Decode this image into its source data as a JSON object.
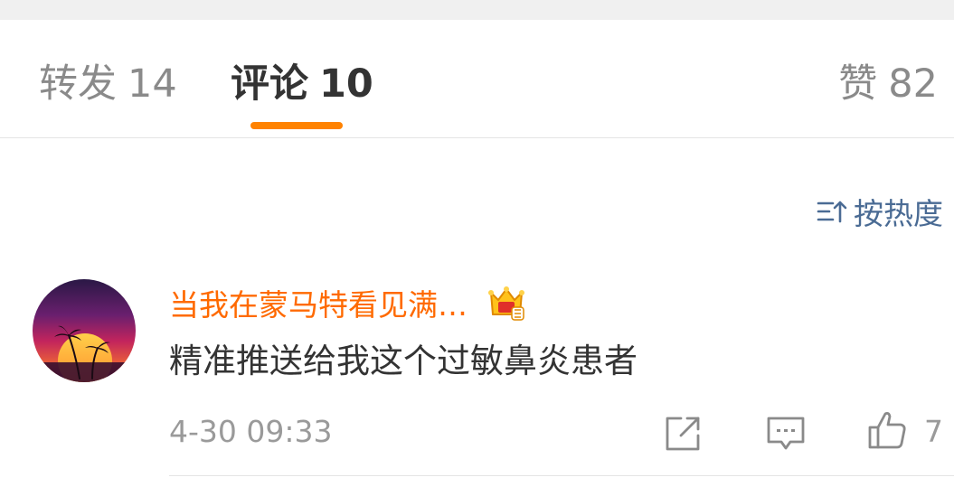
{
  "tabs": {
    "repost": {
      "label": "转发",
      "count": "14"
    },
    "comment": {
      "label": "评论",
      "count": "10"
    },
    "like": {
      "label": "赞",
      "count": "82"
    }
  },
  "sort": {
    "label": "按热度",
    "icon": "sort-icon"
  },
  "comment": {
    "username": "当我在蒙马特看见满…",
    "badge_icon": "vip-crown-icon",
    "text": "精准推送给我这个过敏鼻炎患者",
    "time": "4-30 09:33",
    "like_count": "7"
  },
  "colors": {
    "accent": "#ff8200",
    "username": "#ff6a00",
    "link": "#4a6b94"
  }
}
